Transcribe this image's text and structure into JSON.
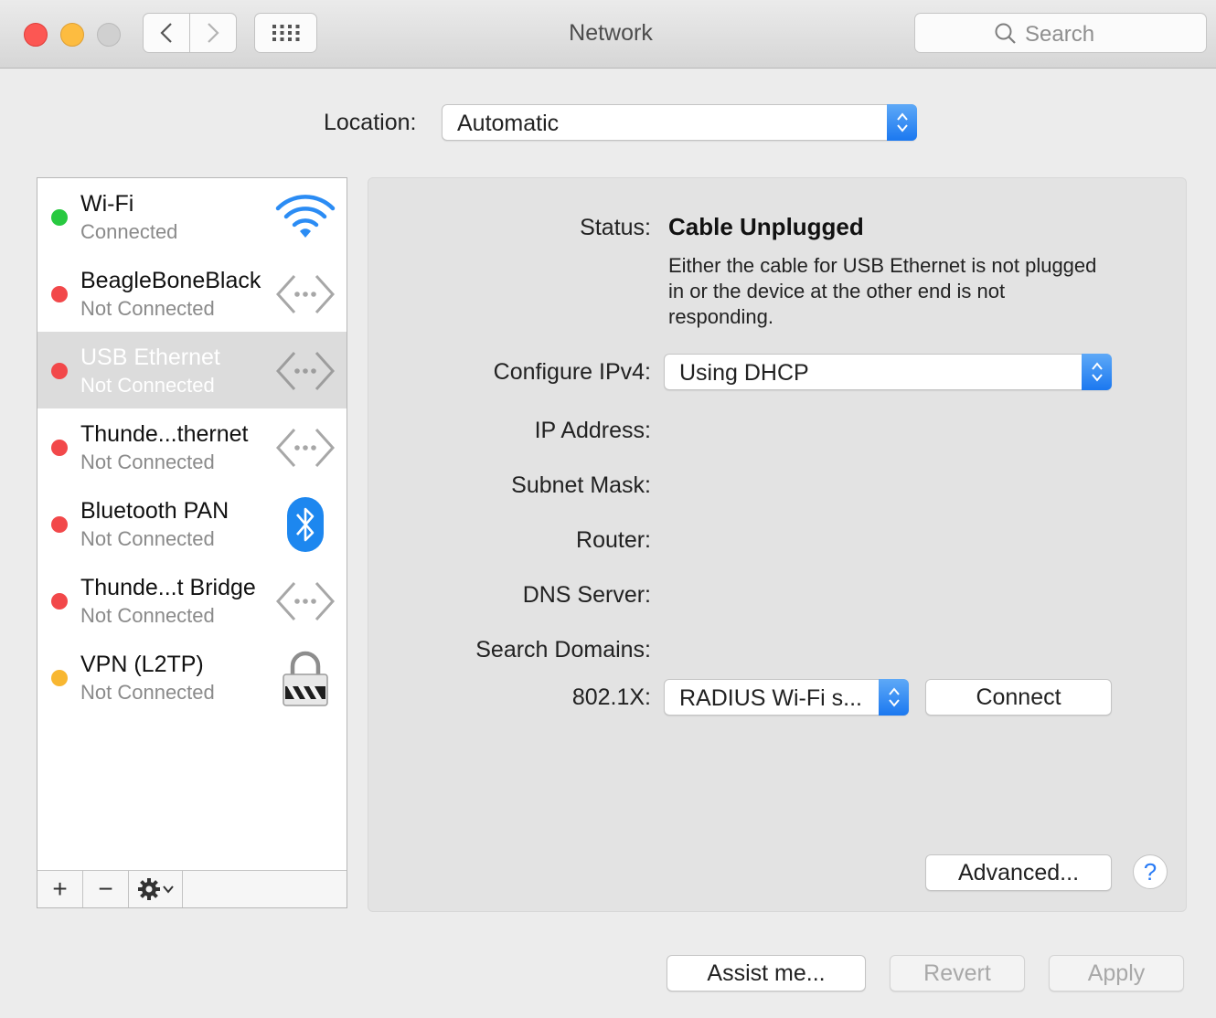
{
  "window": {
    "title": "Network",
    "search_placeholder": "Search"
  },
  "location": {
    "label": "Location:",
    "value": "Automatic"
  },
  "services": [
    {
      "name": "Wi-Fi",
      "status": "Connected",
      "dot_color": "#28c940",
      "icon": "wifi-icon",
      "selected": false
    },
    {
      "name": "BeagleBoneBlack",
      "status": "Not Connected",
      "dot_color": "#f2484a",
      "icon": "ethernet-arrows-icon",
      "selected": false
    },
    {
      "name": "USB Ethernet",
      "status": "Not Connected",
      "dot_color": "#f2484a",
      "icon": "ethernet-arrows-icon",
      "selected": true
    },
    {
      "name": "Thunde...thernet",
      "status": "Not Connected",
      "dot_color": "#f2484a",
      "icon": "ethernet-arrows-icon",
      "selected": false
    },
    {
      "name": "Bluetooth PAN",
      "status": "Not Connected",
      "dot_color": "#f2484a",
      "icon": "bluetooth-icon",
      "selected": false
    },
    {
      "name": "Thunde...t Bridge",
      "status": "Not Connected",
      "dot_color": "#f2484a",
      "icon": "ethernet-arrows-icon",
      "selected": false
    },
    {
      "name": "VPN (L2TP)",
      "status": "Not Connected",
      "dot_color": "#f8b731",
      "icon": "vpn-lock-icon",
      "selected": false
    }
  ],
  "list_toolbar": {
    "add": "+",
    "remove": "−"
  },
  "detail": {
    "status_label": "Status:",
    "status_value": "Cable Unplugged",
    "status_description": "Either the cable for USB Ethernet is not plugged in or the device at the other end is not responding.",
    "configure_ipv4_label": "Configure IPv4:",
    "configure_ipv4_value": "Using DHCP",
    "ip_address_label": "IP Address:",
    "subnet_mask_label": "Subnet Mask:",
    "router_label": "Router:",
    "dns_server_label": "DNS Server:",
    "search_domains_label": "Search Domains:",
    "dot1x_label": "802.1X:",
    "dot1x_value": "RADIUS Wi-Fi s...",
    "connect_label": "Connect",
    "advanced_label": "Advanced...",
    "help_label": "?"
  },
  "footer": {
    "assist_label": "Assist me...",
    "revert_label": "Revert",
    "apply_label": "Apply"
  },
  "colors": {
    "accent": "#1b78f0",
    "selected_row": "#dcdcdc"
  }
}
